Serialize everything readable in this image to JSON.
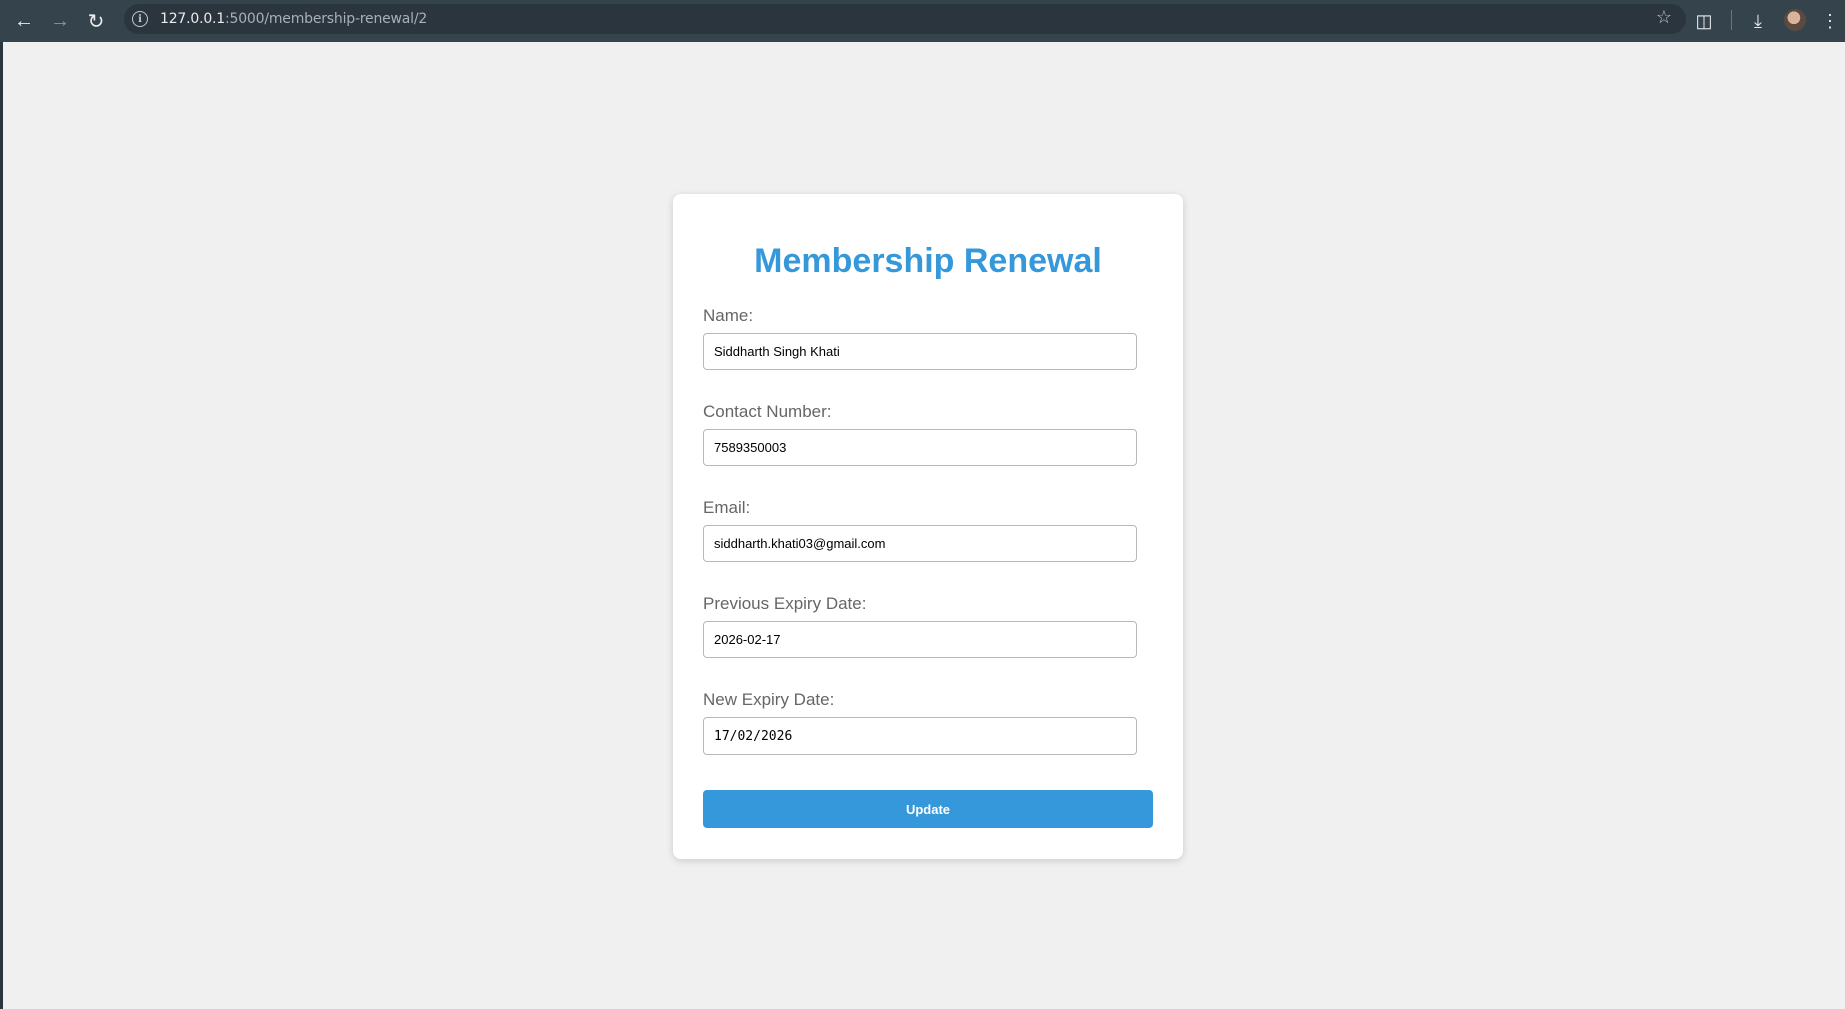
{
  "browser": {
    "url_host": "127.0.0.1",
    "url_path": ":5000/membership-renewal/2"
  },
  "form": {
    "title": "Membership Renewal",
    "fields": [
      {
        "label": "Name:",
        "value": "Siddharth Singh Khati"
      },
      {
        "label": "Contact Number:",
        "value": "7589350003"
      },
      {
        "label": "Email:",
        "value": "siddharth.khati03@gmail.com"
      },
      {
        "label": "Previous Expiry Date:",
        "value": "2026-02-17"
      },
      {
        "label": "New Expiry Date:",
        "value": "17/02/2026"
      }
    ],
    "submit_label": "Update"
  },
  "colors": {
    "accent": "#3498db",
    "page_background": "#f0f0f0",
    "toolbar": "#35434d"
  }
}
